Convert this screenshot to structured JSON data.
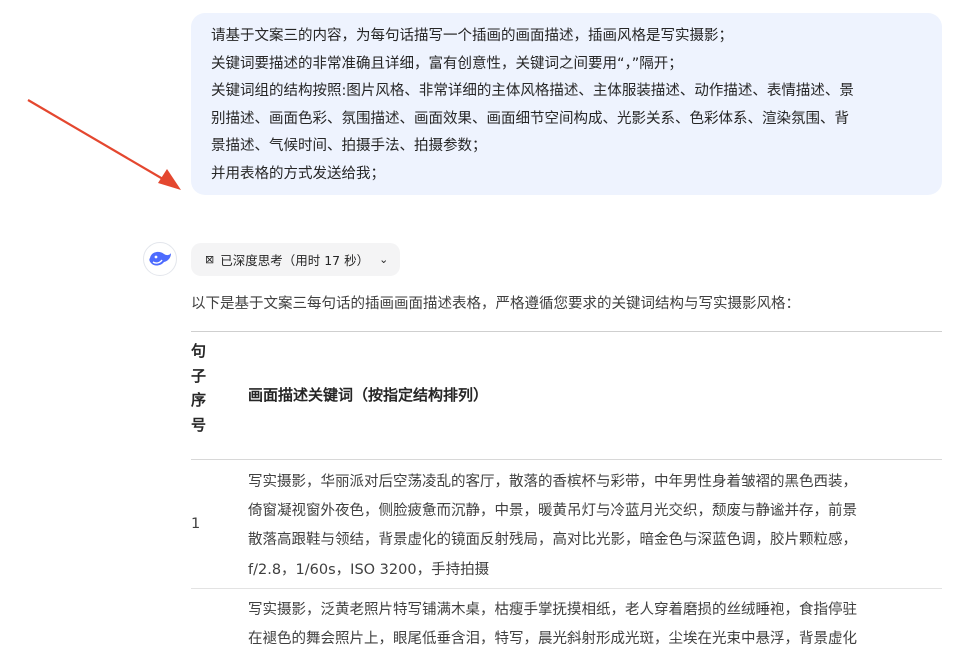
{
  "user_message": {
    "lines": [
      "请基于文案三的内容，为每句话描写一个插画的画面描述，插画风格是写实摄影；",
      "关键词要描述的非常准确且详细，富有创意性，关键词之间要用“，”隔开；",
      "关键词组的结构按照:图片风格、非常详细的主体风格描述、主体服装描述、动作描述、表情描述、景",
      "别描述、画面色彩、氛围描述、画面效果、画面细节空间构成、光影关系、色彩体系、渲染氛围、背",
      "景描述、气候时间、拍摄手法、拍摄参数；",
      "并用表格的方式发送给我；"
    ]
  },
  "assistant": {
    "thinking_label": "已深度思考（用时 17 秒）",
    "intro": "以下是基于文案三每句话的插画画面描述表格，严格遵循您要求的关键词结构与写实摄影风格：",
    "table": {
      "header_num": "句子序号",
      "header_title": "画面描述关键词（按指定结构排列）",
      "rows": [
        {
          "num": "1",
          "lines": [
            "写实摄影，华丽派对后空荡凌乱的客厅，散落的香槟杯与彩带，中年男性身着皱褶的黑色西装，",
            "倚窗凝视窗外夜色，侧脸疲惫而沉静，中景，暖黄吊灯与冷蓝月光交织，颓废与静谧并存，前景",
            "散落高跟鞋与领结，背景虚化的镜面反射残局，高对比光影，暗金色与深蓝色调，胶片颗粒感，",
            "f/2.8，1/60s，ISO 3200，手持拍摄"
          ]
        },
        {
          "num": "",
          "lines": [
            "写实摄影，泛黄老照片特写铺满木桌，枯瘦手掌抚摸相纸，老人穿着磨损的丝绒睡袍，食指停驻",
            "在褪色的舞会照片上，眼尾低垂含泪，特写，晨光斜射形成光斑，尘埃在光束中悬浮，背景虚化"
          ]
        }
      ]
    }
  }
}
